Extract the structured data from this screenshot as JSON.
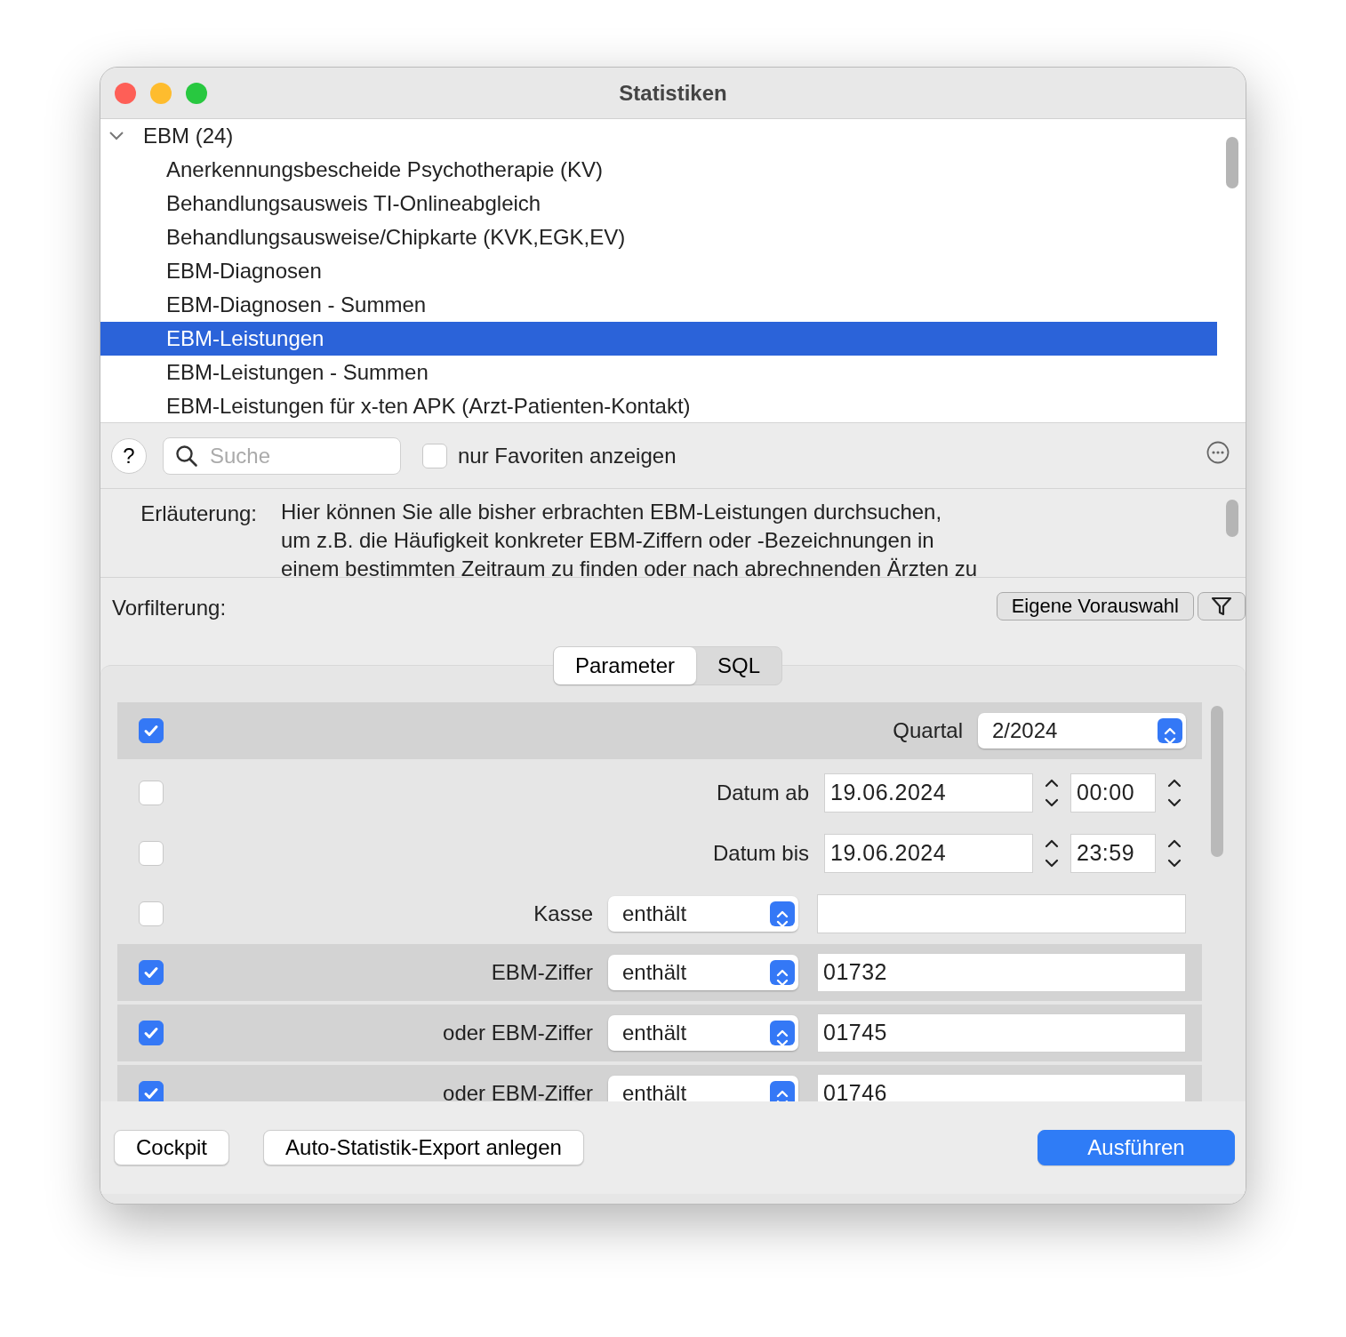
{
  "window": {
    "title": "Statistiken"
  },
  "tree": {
    "label": "EBM (24)",
    "expanded": true,
    "children": [
      {
        "label": "Anerkennungsbescheide Psychotherapie (KV)",
        "selected": false
      },
      {
        "label": "Behandlungsausweis TI-Onlineabgleich",
        "selected": false
      },
      {
        "label": "Behandlungsausweise/Chipkarte (KVK,EGK,EV)",
        "selected": false
      },
      {
        "label": "EBM-Diagnosen",
        "selected": false
      },
      {
        "label": "EBM-Diagnosen - Summen",
        "selected": false
      },
      {
        "label": "EBM-Leistungen",
        "selected": true
      },
      {
        "label": "EBM-Leistungen - Summen",
        "selected": false
      },
      {
        "label": "EBM-Leistungen für x-ten APK (Arzt-Patienten-Kontakt)",
        "selected": false
      }
    ]
  },
  "toolbar": {
    "help": "?",
    "search": {
      "placeholder": "Suche"
    },
    "favorites": {
      "label": "nur Favoriten anzeigen",
      "checked": false
    }
  },
  "explanation": {
    "label": "Erläuterung:",
    "lines": [
      "Hier können Sie alle bisher erbrachten EBM-Leistungen durchsuchen,",
      "um z.B. die Häufigkeit konkreter EBM-Ziffern oder -Bezeichnungen in",
      "einem bestimmten Zeitraum zu finden oder nach abrechnenden Ärzten zu"
    ]
  },
  "prefilter": {
    "label": "Vorfilterung:",
    "button": "Eigene Vorauswahl"
  },
  "tabs": [
    {
      "label": "Parameter",
      "selected": true
    },
    {
      "label": "SQL",
      "selected": false
    }
  ],
  "params": [
    {
      "kind": "select",
      "checked": true,
      "label": "Quartal",
      "value": "2/2024"
    },
    {
      "kind": "datetime",
      "checked": false,
      "label": "Datum ab",
      "date": "19.06.2024",
      "time": "00:00"
    },
    {
      "kind": "datetime",
      "checked": false,
      "label": "Datum bis",
      "date": "19.06.2024",
      "time": "23:59"
    },
    {
      "kind": "text",
      "checked": false,
      "label": "Kasse",
      "operator": "enthält"
    },
    {
      "kind": "text",
      "checked": true,
      "label": "EBM-Ziffer",
      "operator": "enthält",
      "value": "01732"
    },
    {
      "kind": "text",
      "checked": true,
      "label": "oder EBM-Ziffer",
      "operator": "enthält",
      "value": "01745"
    },
    {
      "kind": "text",
      "checked": true,
      "label": "oder EBM-Ziffer",
      "operator": "enthält",
      "value": "01746"
    }
  ],
  "buttons": [
    {
      "label": "Cockpit",
      "kind": "default"
    },
    {
      "label": "Auto-Statistik-Export anlegen",
      "kind": "default"
    },
    {
      "label": "Ausführen",
      "kind": "primary"
    }
  ]
}
